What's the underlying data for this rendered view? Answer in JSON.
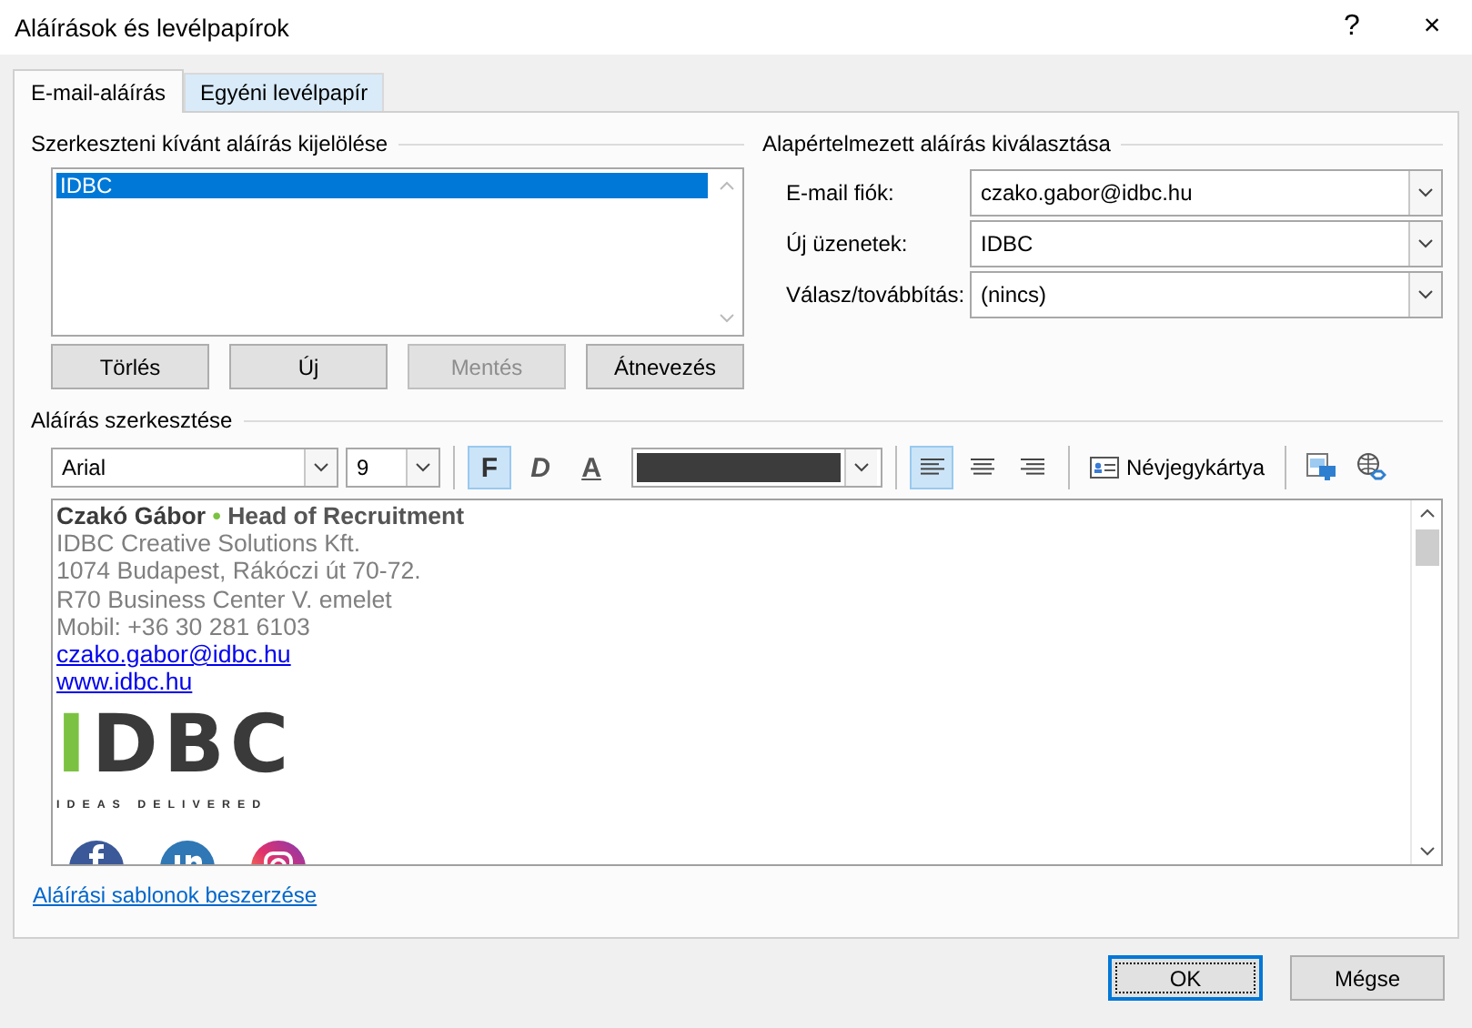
{
  "window": {
    "title": "Aláírások és levélpapírok",
    "help": "?",
    "close": "×"
  },
  "tabs": [
    {
      "label": "E-mail-aláírás",
      "selected": true
    },
    {
      "label": "Egyéni levélpapír",
      "selected": false
    }
  ],
  "select_group": {
    "label": "Szerkeszteni kívánt aláírás kijelölése",
    "items": [
      {
        "label": "IDBC",
        "selected": true
      }
    ],
    "buttons": [
      {
        "label": "Törlés",
        "disabled": false
      },
      {
        "label": "Új",
        "disabled": false
      },
      {
        "label": "Mentés",
        "disabled": true
      },
      {
        "label": "Átnevezés",
        "disabled": false
      }
    ]
  },
  "default_group": {
    "label": "Alapértelmezett aláírás kiválasztása",
    "fields": [
      {
        "label": "E-mail fiók:",
        "value": "czako.gabor@idbc.hu"
      },
      {
        "label": "Új üzenetek:",
        "value": "IDBC"
      },
      {
        "label": "Válasz/továbbítás:",
        "value": "(nincs)"
      }
    ]
  },
  "editor": {
    "label": "Aláírás szerkesztése",
    "font": "Arial",
    "size": "9",
    "styles": [
      {
        "label": "F",
        "kind": "bold",
        "selected": true
      },
      {
        "label": "D",
        "kind": "italic",
        "selected": false
      },
      {
        "label": "A",
        "kind": "underline",
        "selected": false
      }
    ],
    "color": "#3c3c3c",
    "align": [
      {
        "kind": "left",
        "selected": true
      },
      {
        "kind": "center",
        "selected": false
      },
      {
        "kind": "right",
        "selected": false
      }
    ],
    "card_button": "Névjegykártya",
    "signature": {
      "name": "Czakó Gábor",
      "separator": "•",
      "title": "Head of Recruitment",
      "lines": [
        {
          "kind": "text",
          "text": "IDBC Creative Solutions Kft."
        },
        {
          "kind": "text",
          "text": "1074 Budapest, Rákóczi út 70-72."
        },
        {
          "kind": "text",
          "text": "R70 Business Center V. emelet"
        },
        {
          "kind": "text",
          "text": "Mobil: +36 30 281 6103"
        },
        {
          "kind": "link",
          "text": "czako.gabor@idbc.hu"
        },
        {
          "kind": "link",
          "text": "www.idbc.hu"
        }
      ],
      "logo": {
        "wordmark": "IDBC",
        "tagline": "IDEAS DELIVERED"
      }
    }
  },
  "templates_link": "Aláírási sablonok beszerzése",
  "footer_buttons": [
    {
      "label": "OK",
      "kind": "default"
    },
    {
      "label": "Mégse",
      "kind": "normal"
    }
  ]
}
